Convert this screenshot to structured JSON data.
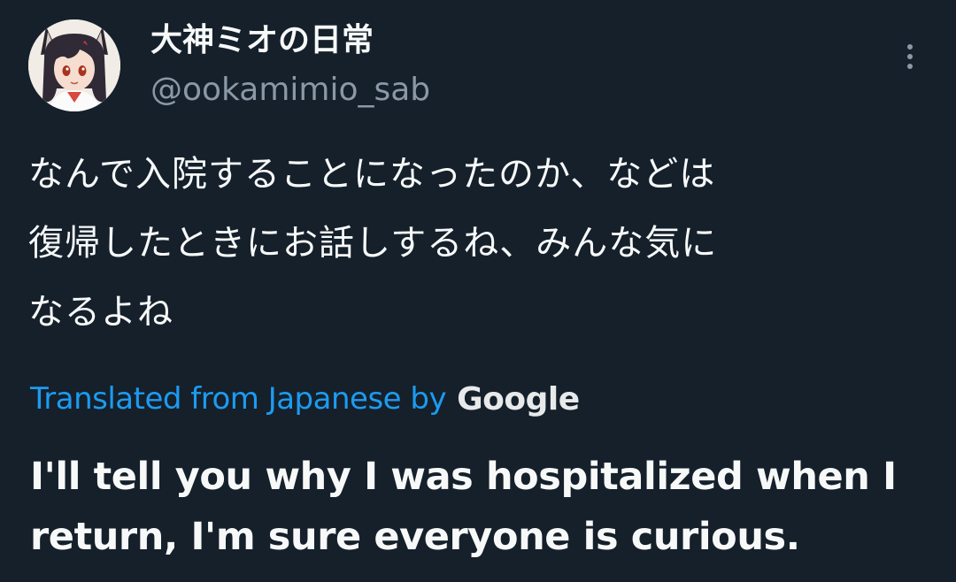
{
  "user": {
    "display_name": "大神ミオの日常",
    "handle": "@ookamimio_sab"
  },
  "tweet": {
    "original_text": "なんで入院することになったのか、などは\n復帰したときにお話しするね、みんな気に\nなるよね",
    "translation_label": "Translated from Japanese by",
    "translation_provider": "Google",
    "translated_text": "I'll tell you why I was hospitalized when I return, I'm sure everyone is curious."
  },
  "colors": {
    "background": "#15202b",
    "text_primary": "#f7f9f9",
    "text_secondary": "#8b98a5",
    "link": "#1d9bf0"
  },
  "icons": {
    "more": "more-vertical-icon",
    "avatar": "avatar-image"
  }
}
